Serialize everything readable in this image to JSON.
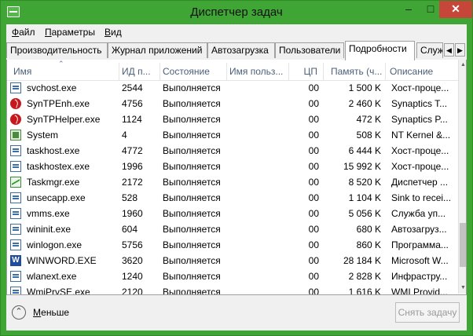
{
  "window": {
    "title": "Диспетчер задач"
  },
  "menu": [
    {
      "label": "Файл",
      "hotkey": "Ф",
      "rest": "айл"
    },
    {
      "label": "Параметры",
      "hotkey": "П",
      "rest": "араметры"
    },
    {
      "label": "Вид",
      "hotkey": "В",
      "rest": "ид"
    }
  ],
  "tabs": [
    {
      "label": "Производительность"
    },
    {
      "label": "Журнал приложений"
    },
    {
      "label": "Автозагрузка"
    },
    {
      "label": "Пользователи"
    },
    {
      "label": "Подробности"
    },
    {
      "label": "Службы"
    }
  ],
  "columns": [
    "Имя",
    "ИД п...",
    "Состояние",
    "Имя польз...",
    "ЦП",
    "Память (ч...",
    "Описание"
  ],
  "processes": [
    {
      "name": "svchost.exe",
      "pid": "2544",
      "state": "Выполняется",
      "user": "",
      "cpu": "00",
      "memory": "1 500 K",
      "description": "Хост-проце...",
      "icon": "service-icon"
    },
    {
      "name": "SynTPEnh.exe",
      "pid": "4756",
      "state": "Выполняется",
      "user": "",
      "cpu": "00",
      "memory": "2 460 K",
      "description": "Synaptics T...",
      "icon": "synaptics-icon"
    },
    {
      "name": "SynTPHelper.exe",
      "pid": "1124",
      "state": "Выполняется",
      "user": "",
      "cpu": "00",
      "memory": "472 K",
      "description": "Synaptics P...",
      "icon": "synaptics-icon"
    },
    {
      "name": "System",
      "pid": "4",
      "state": "Выполняется",
      "user": "",
      "cpu": "00",
      "memory": "508 K",
      "description": "NT Kernel &...",
      "icon": "system-icon"
    },
    {
      "name": "taskhost.exe",
      "pid": "4772",
      "state": "Выполняется",
      "user": "",
      "cpu": "00",
      "memory": "6 444 K",
      "description": "Хост-проце...",
      "icon": "service-icon"
    },
    {
      "name": "taskhostex.exe",
      "pid": "1996",
      "state": "Выполняется",
      "user": "",
      "cpu": "00",
      "memory": "15 992 K",
      "description": "Хост-проце...",
      "icon": "service-icon"
    },
    {
      "name": "Taskmgr.exe",
      "pid": "2172",
      "state": "Выполняется",
      "user": "",
      "cpu": "00",
      "memory": "8 520 K",
      "description": "Диспетчер ...",
      "icon": "taskmgr-icon"
    },
    {
      "name": "unsecapp.exe",
      "pid": "528",
      "state": "Выполняется",
      "user": "",
      "cpu": "00",
      "memory": "1 104 K",
      "description": "Sink to recei...",
      "icon": "service-icon"
    },
    {
      "name": "vmms.exe",
      "pid": "1960",
      "state": "Выполняется",
      "user": "",
      "cpu": "00",
      "memory": "5 056 K",
      "description": "Служба уп...",
      "icon": "service-icon"
    },
    {
      "name": "wininit.exe",
      "pid": "604",
      "state": "Выполняется",
      "user": "",
      "cpu": "00",
      "memory": "680 K",
      "description": "Автозагруз...",
      "icon": "service-icon"
    },
    {
      "name": "winlogon.exe",
      "pid": "5756",
      "state": "Выполняется",
      "user": "",
      "cpu": "00",
      "memory": "860 K",
      "description": "Программа...",
      "icon": "service-icon"
    },
    {
      "name": "WINWORD.EXE",
      "pid": "3620",
      "state": "Выполняется",
      "user": "",
      "cpu": "00",
      "memory": "28 184 K",
      "description": "Microsoft W...",
      "icon": "word-icon"
    },
    {
      "name": "wlanext.exe",
      "pid": "1240",
      "state": "Выполняется",
      "user": "",
      "cpu": "00",
      "memory": "2 828 K",
      "description": "Инфрастру...",
      "icon": "service-icon"
    },
    {
      "name": "WmiPrvSE.exe",
      "pid": "2120",
      "state": "Выполняется",
      "user": "",
      "cpu": "00",
      "memory": "1 616 K",
      "description": "WMI Provid...",
      "icon": "service-icon"
    }
  ],
  "footer": {
    "less_label": "Меньше",
    "less_hotkey": "М",
    "less_rest": "еньше",
    "end_task_label": "Снять задачу"
  }
}
